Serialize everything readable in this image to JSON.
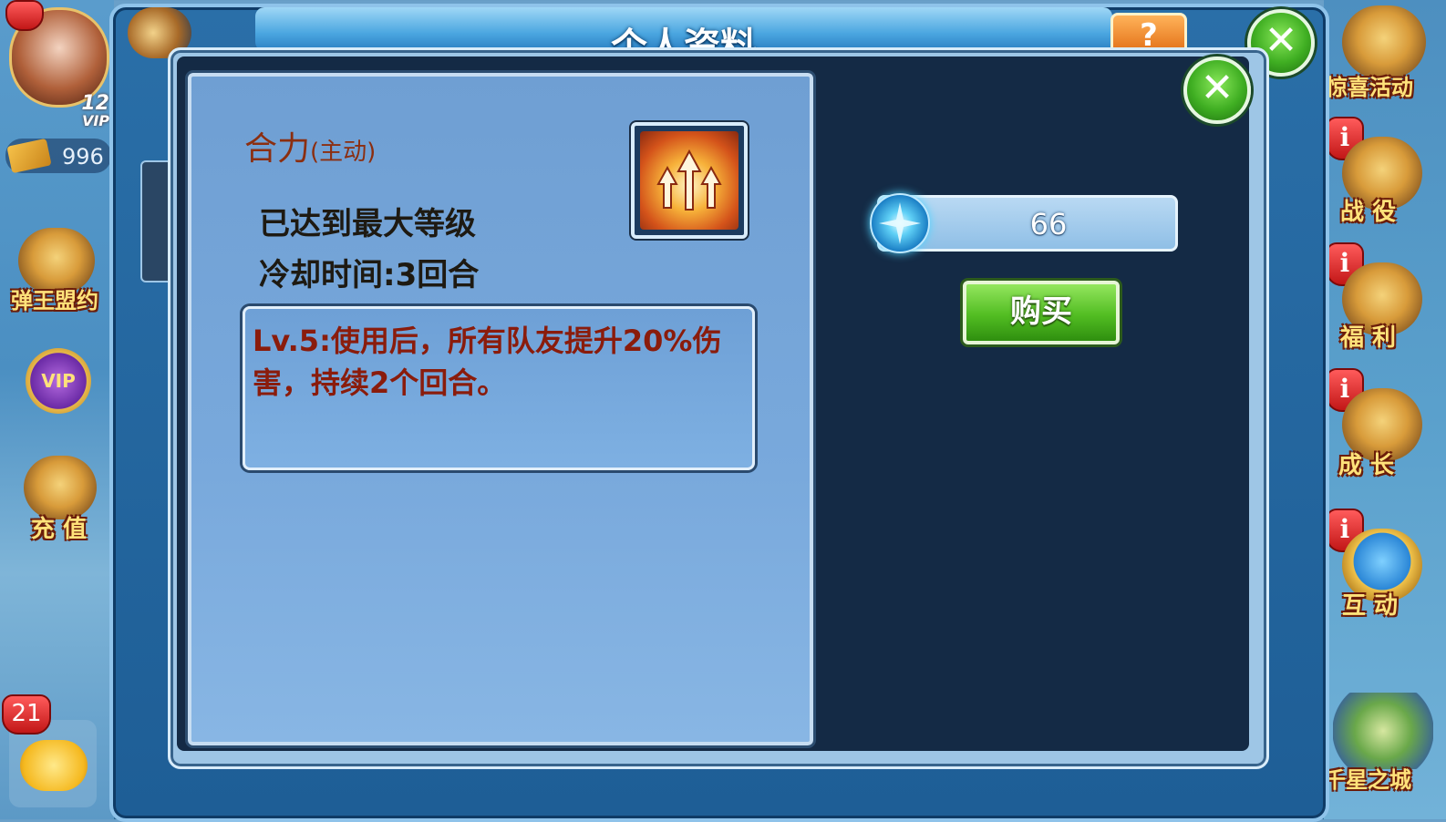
{
  "window": {
    "title": "个人资料",
    "help_label": "?",
    "close_label": "✕"
  },
  "left_sidebar": {
    "vip_level": "12",
    "vip_label": "VIP",
    "currency_value": "996",
    "items": [
      {
        "label": "弹王盟约",
        "icon": "scroll-icon"
      },
      {
        "label": "",
        "icon": "vip-badge-icon"
      },
      {
        "label": "充 值",
        "icon": "treasure-chest-icon"
      }
    ],
    "chat_badge": "21"
  },
  "right_sidebar": {
    "items": [
      {
        "label": "惊喜活动",
        "icon": "treasure-icon",
        "badge": ""
      },
      {
        "label": "战 役",
        "icon": "map-scroll-icon",
        "badge": "i"
      },
      {
        "label": "福 利",
        "icon": "gift-icon",
        "badge": "i"
      },
      {
        "label": "成 长",
        "icon": "growth-icon",
        "badge": "i"
      },
      {
        "label": "互 动",
        "icon": "interact-icon",
        "badge": "i"
      },
      {
        "label": "千星之城",
        "icon": "city-icon",
        "badge": ""
      }
    ]
  },
  "skill": {
    "name": "合力",
    "type": "(主动)",
    "level_status": "已达到最大等级",
    "cooldown": "冷却时间:3回合",
    "description": "Lv.5:使用后，所有队友提升20%伤害，持续2个回合。",
    "icon": "triple-arrow-swirl-icon"
  },
  "purchase": {
    "gem_count": "66",
    "gem_icon": "blue-gem-icon",
    "buy_label": "购买"
  },
  "colors": {
    "panel_blue": "#79a9dc",
    "dark_panel": "#142a45",
    "buy_green": "#52bd22",
    "desc_red": "#8a1c0c"
  }
}
